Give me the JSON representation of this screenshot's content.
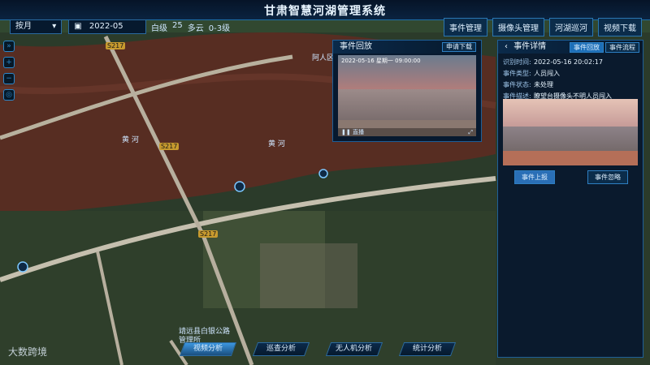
{
  "header": {
    "title": "甘肃智慧河湖管理系统",
    "nav": [
      "事件管理",
      "摄像头管理",
      "河湖巡河",
      "视频下载"
    ]
  },
  "filters": {
    "period": "按月",
    "period_icon": "chevron-down-icon",
    "date": "2022-05",
    "date_icon": "calendar-icon"
  },
  "weather": {
    "level": "白级",
    "temp": "25",
    "condition": "多云",
    "wind": "0-3级"
  },
  "map": {
    "labels": {
      "yellow_river_1": "黄 河",
      "yellow_river_2": "黄 河",
      "county_office": "靖远县白银公路管理所",
      "west_label": "阿人区",
      "road_s217_1": "S217",
      "road_s217_2": "S217",
      "road_s217_3": "S217"
    }
  },
  "video_panel": {
    "title": "事件回放",
    "download_button": "申请下载",
    "overlay_text": "2022-05-16 星期一 09:00:00",
    "play_icon": "pause-icon",
    "play_label": "直播",
    "fullscreen_icon": "expand-icon"
  },
  "details_panel": {
    "title": "事件详情",
    "tabs": [
      "事件回放",
      "事件流程"
    ],
    "fields": {
      "time_label": "识别时间:",
      "time_value": "2022-05-16 20:02:17",
      "type_label": "事件类型:",
      "type_value": "人员闯入",
      "status_label": "事件状态:",
      "status_value": "未处理",
      "desc_label": "事件描述:",
      "desc_value": "瞭望台摄像头不明人员闯入"
    },
    "buttons": {
      "report": "事件上报",
      "ignore": "事件忽略"
    }
  },
  "bottom_tabs": [
    {
      "label": "视频分析",
      "active": true
    },
    {
      "label": "巡查分析",
      "active": false
    },
    {
      "label": "无人机分析",
      "active": false
    },
    {
      "label": "统计分析",
      "active": false
    }
  ],
  "watermark": "大数跨境"
}
